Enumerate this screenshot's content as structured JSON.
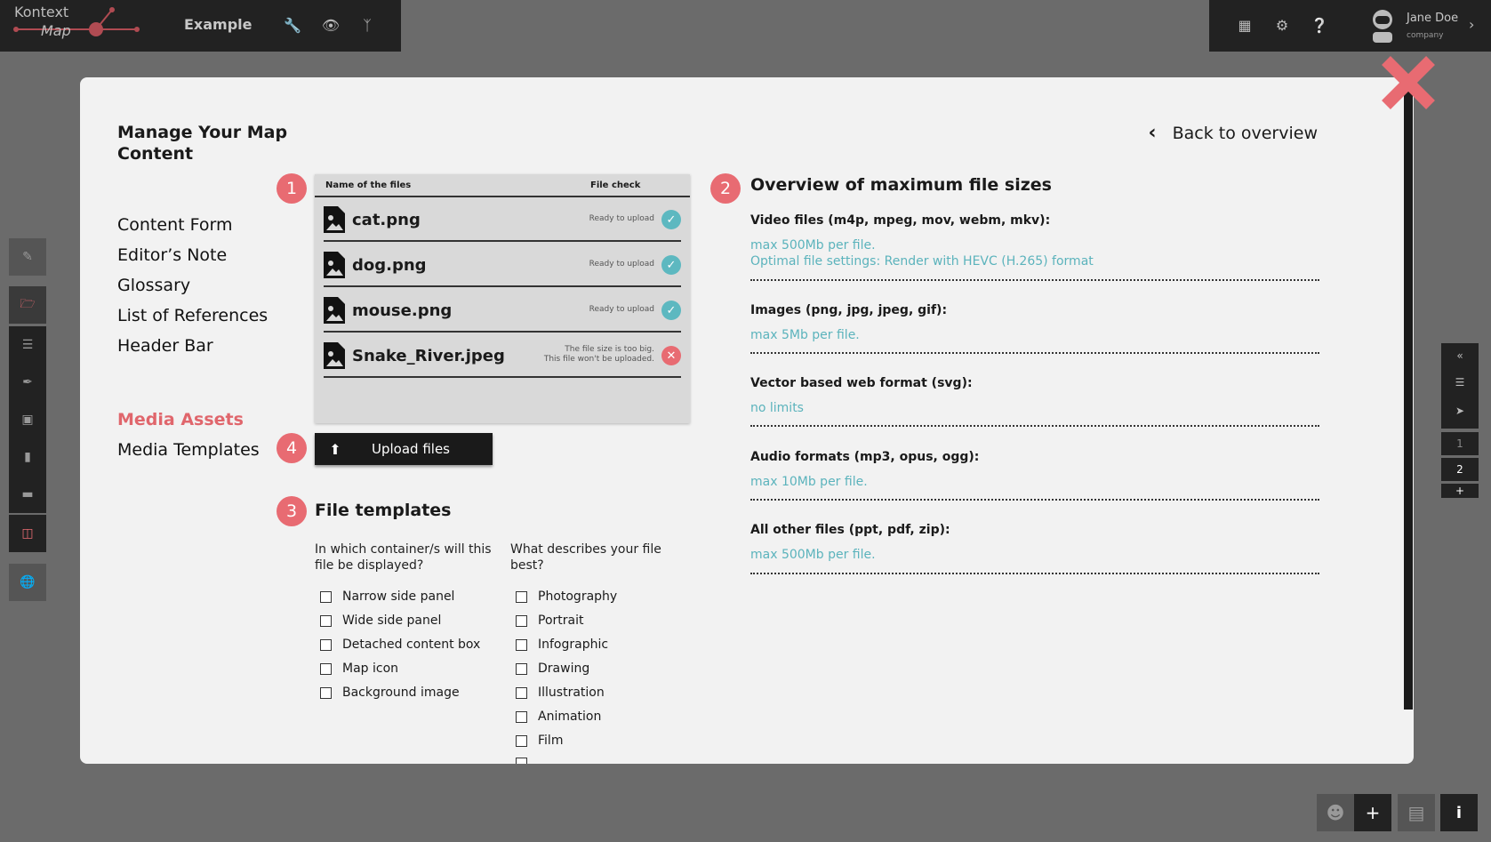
{
  "app": {
    "logo_top": "Kontext",
    "logo_bottom": "Map",
    "project": "Example",
    "user_name": "Jane Doe",
    "user_company": "company"
  },
  "modal": {
    "title": "Manage Your Map Content",
    "back_label": "Back to overview",
    "nav": [
      "Content Form",
      "Editor’s Note",
      "Glossary",
      "List of References",
      "Header Bar"
    ],
    "nav2": [
      "Media Assets",
      "Media Templates"
    ],
    "active_nav": "Media Assets"
  },
  "files": {
    "badge": "1",
    "col_name": "Name of the files",
    "col_check": "File check",
    "rows": [
      {
        "name": "cat.png",
        "status": "Ready to upload",
        "ok": true
      },
      {
        "name": "dog.png",
        "status": "Ready to upload",
        "ok": true
      },
      {
        "name": "mouse.png",
        "status": "Ready to upload",
        "ok": true
      },
      {
        "name": "Snake_River.jpeg",
        "status1": "The file size is too big.",
        "status2": "This file won't be uploaded.",
        "ok": false
      }
    ]
  },
  "upload": {
    "badge": "4",
    "label": "Upload files"
  },
  "templates": {
    "badge": "3",
    "title": "File templates",
    "q1": "In which container/s will this file be displayed?",
    "q2": "What describes your file best?",
    "containers": [
      "Narrow side panel",
      "Wide side panel",
      "Detached content box",
      "Map icon",
      "Background image"
    ],
    "describes": [
      "Photography",
      "Portrait",
      "Infographic",
      "Drawing",
      "Illustration",
      "Animation",
      "Film"
    ]
  },
  "limits": {
    "badge": "2",
    "title": "Overview of maximum file sizes",
    "groups": [
      {
        "head": "Video files (m4p, mpeg, mov, webm, mkv):",
        "lines": [
          "max 500Mb per file.",
          "Optimal file settings: Render with HEVC (H.265) format"
        ]
      },
      {
        "head": "Images (png, jpg, jpeg, gif):",
        "lines": [
          "max 5Mb per file."
        ]
      },
      {
        "head": "Vector based web format (svg):",
        "lines": [
          "no limits"
        ]
      },
      {
        "head": "Audio formats (mp3, opus, ogg):",
        "lines": [
          "max 10Mb per file."
        ]
      },
      {
        "head": "All other files (ppt, pdf, zip):",
        "lines": [
          "max 500Mb per file."
        ]
      }
    ]
  },
  "right_panel": {
    "pages": [
      "1",
      "2",
      "+"
    ]
  },
  "colors": {
    "accent": "#e86b72",
    "link": "#5bb3bc",
    "ok": "#5db8c0"
  }
}
